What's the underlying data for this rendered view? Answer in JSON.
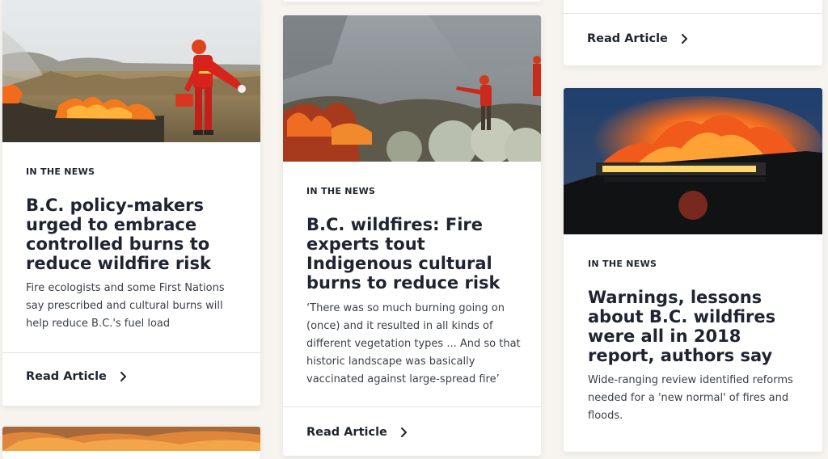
{
  "cards": [
    {
      "kicker": "IN THE NEWS",
      "title": "B.C. policy-makers urged to embrace controlled burns to reduce wildfire risk",
      "description": "Fire ecologists and some First Nations say prescribed and cultural burns will help reduce B.C.'s fuel load",
      "read_label": "Read Article"
    },
    {
      "kicker": "IN THE NEWS",
      "title": "B.C. wildfires: Fire experts tout Indigenous cultural burns to reduce risk",
      "description": "‘There was so much burning going on (once) and it resulted in all kinds of different vegetation types ... And so that historic landscape was basically vaccinated against large-spread fire’",
      "read_label": "Read Article"
    },
    {
      "kicker": "IN THE NEWS",
      "title": "Warnings, lessons about B.C. wildfires were all in 2018 report, authors say",
      "description": "Wide-ranging review identified reforms needed for a 'new normal' of fires and floods.",
      "read_label": "Read Article"
    }
  ],
  "top_right_read_label": "Read Article",
  "colors": {
    "background": "#f7f4ef",
    "card": "#ffffff",
    "text": "#1f2430",
    "fire": "#f26a1b"
  }
}
